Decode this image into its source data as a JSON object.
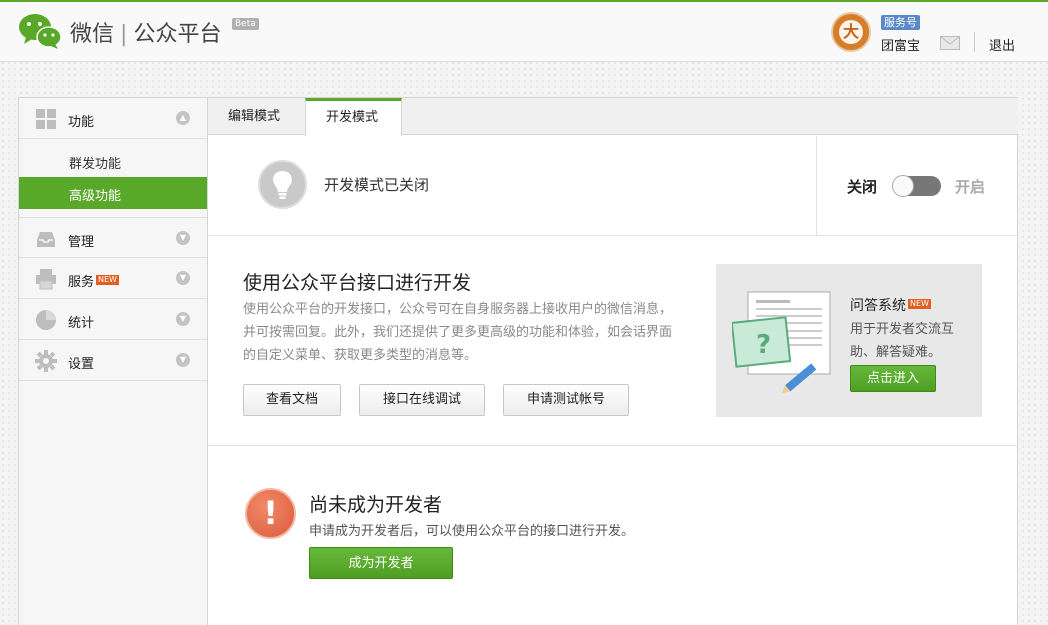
{
  "header": {
    "brand_wechat": "微信",
    "brand_sep": "|",
    "brand_platform": "公众平台",
    "beta": "Beta",
    "account_badge": "服务号",
    "account_name": "团富宝",
    "avatar_char": "大",
    "logout": "退出"
  },
  "sidebar": {
    "groups": [
      {
        "label": "功能",
        "icon": "grid-icon"
      },
      {
        "label": "管理",
        "icon": "inbox-icon"
      },
      {
        "label": "服务",
        "icon": "printer-icon",
        "badge": "NEW"
      },
      {
        "label": "统计",
        "icon": "pie-chart-icon"
      },
      {
        "label": "设置",
        "icon": "gear-icon"
      }
    ],
    "sub_items": [
      {
        "label": "群发功能",
        "active": false
      },
      {
        "label": "高级功能",
        "active": true
      }
    ]
  },
  "tabs": [
    {
      "label": "编辑模式",
      "active": false
    },
    {
      "label": "开发模式",
      "active": true
    }
  ],
  "status": {
    "text": "开发模式已关闭",
    "off_label": "关闭",
    "on_label": "开启",
    "enabled": false
  },
  "api": {
    "title": "使用公众平台接口进行开发",
    "description": "使用公众平台的开发接口，公众号可在自身服务器上接收用户的微信消息，并可按需回复。此外，我们还提供了更多更高级的功能和体验，如会话界面的自定义菜单、获取更多类型的消息等。",
    "buttons": [
      "查看文档",
      "接口在线调试",
      "申请测试帐号"
    ]
  },
  "qa": {
    "title": "问答系统",
    "badge": "NEW",
    "description": "用于开发者交流互助、解答疑难。",
    "button": "点击进入"
  },
  "developer": {
    "title": "尚未成为开发者",
    "description": "申请成为开发者后，可以使用公众平台的接口进行开发。",
    "button": "成为开发者"
  },
  "colors": {
    "accent_green": "#5aa82a",
    "badge_blue": "#5a88c8",
    "new_badge": "#e06020",
    "warning": "#dc5a3a"
  }
}
